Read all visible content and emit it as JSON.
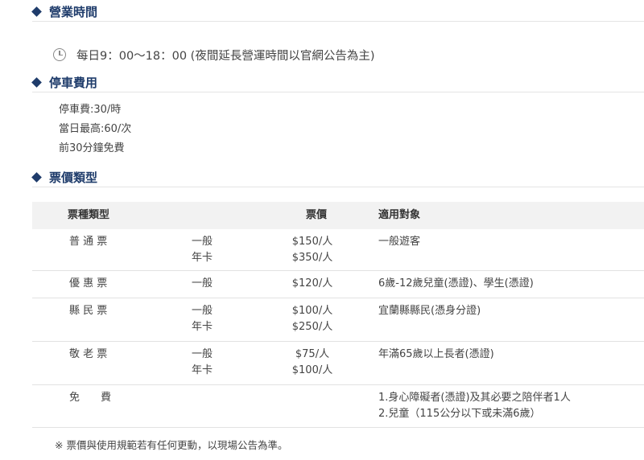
{
  "sections": {
    "hours_title": "營業時間",
    "parking_title": "停車費用",
    "ticket_title": "票價類型"
  },
  "hours": {
    "icon": "clock-icon",
    "text": "每日9：00～18：00 (夜間延長營運時間以官網公告為主)"
  },
  "parking": [
    "停車費:30/時",
    "當日最高:60/次",
    "前30分鐘免費"
  ],
  "table": {
    "headers": {
      "type": "票種類型",
      "price": "票價",
      "target": "適用對象"
    },
    "rows": [
      {
        "name": "普 通 票",
        "subtypes": [
          "一般",
          "年卡"
        ],
        "prices": [
          "$150/人",
          "$350/人"
        ],
        "targets": [
          "一般遊客"
        ]
      },
      {
        "name": "優 惠 票",
        "subtypes": [
          "一般"
        ],
        "prices": [
          "$120/人"
        ],
        "targets": [
          "6歲-12歲兒童(憑證)、學生(憑證)"
        ]
      },
      {
        "name": "縣 民 票",
        "subtypes": [
          "一般",
          "年卡"
        ],
        "prices": [
          "$100/人",
          "$250/人"
        ],
        "targets": [
          "宜蘭縣縣民(憑身分證)"
        ]
      },
      {
        "name": "敬 老 票",
        "subtypes": [
          "一般",
          "年卡"
        ],
        "prices": [
          "$75/人",
          "$100/人"
        ],
        "targets": [
          "年滿65歲以上長者(憑證)"
        ]
      },
      {
        "name": "免　　費",
        "subtypes": [],
        "prices": [],
        "targets": [
          "1.身心障礙者(憑證)及其必要之陪伴者1人",
          "2.兒童（115公分以下或未滿6歲）"
        ]
      }
    ]
  },
  "note": "※ 票價與使用規範若有任何更動，以現場公告為準。"
}
